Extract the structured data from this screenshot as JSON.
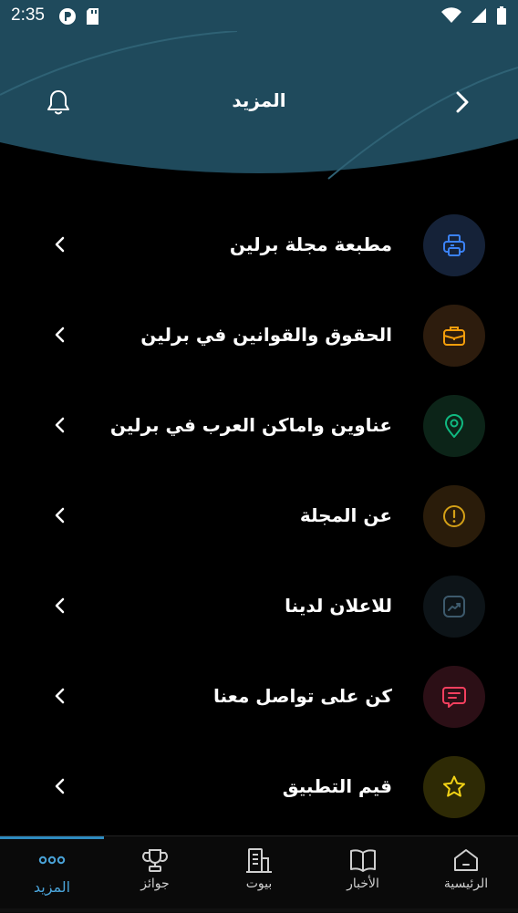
{
  "status_bar": {
    "time": "2:35"
  },
  "header": {
    "title": "المزيد"
  },
  "menu": [
    {
      "label": "مطبعة مجلة برلين",
      "icon": "printer-icon",
      "color": "#3b82f6",
      "bg": "#152238"
    },
    {
      "label": "الحقوق والقوانين في برلين",
      "icon": "briefcase-icon",
      "color": "#f59e0b",
      "bg": "#2d1c0d"
    },
    {
      "label": "عناوين واماكن العرب في برلين",
      "icon": "location-pin-icon",
      "color": "#10b981",
      "bg": "#0c2418"
    },
    {
      "label": "عن المجلة",
      "icon": "info-circle-icon",
      "color": "#d4a017",
      "bg": "#2a1c0a"
    },
    {
      "label": "للاعلان لدينا",
      "icon": "trending-chart-icon",
      "color": "#3d5a6c",
      "bg": "#0d1418"
    },
    {
      "label": "كن على تواصل معنا",
      "icon": "chat-message-icon",
      "color": "#f43f5e",
      "bg": "#2c0f16"
    },
    {
      "label": "قيم التطبيق",
      "icon": "star-icon",
      "color": "#f2d216",
      "bg": "#2e2a05"
    }
  ],
  "bottom_nav": {
    "more": "المزيد",
    "awards": "جوائز",
    "homes": "بيوت",
    "news": "الأخبار",
    "home": "الرئيسية"
  },
  "colors": {
    "header": "#1f4a5c",
    "accent": "#4aa3d8"
  }
}
